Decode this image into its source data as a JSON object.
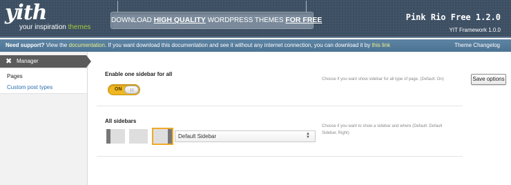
{
  "header": {
    "logo_text": "yith",
    "tagline_prefix": "your inspiration",
    "tagline_accent": "themes",
    "banner_prefix": "DOWNLOAD",
    "banner_bold1": "HIGH QUALITY",
    "banner_middle": "WORDPRESS THEMES",
    "banner_bold2": "FOR FREE",
    "product_name": "Pink Rio Free 1.2.0",
    "framework_version": "YIT Framework 1.0.0"
  },
  "support_bar": {
    "need_support": "Need support?",
    "text_view": "View the",
    "link_documentation": "documentation",
    "text_middle": ". If you want download this documentation and see it without any internet connection, you can download it by",
    "link_this": "this link",
    "changelog": "Theme Changelog"
  },
  "sidebar": {
    "manager_label": "Manager",
    "items": [
      {
        "label": "Pages"
      },
      {
        "label": "Custom post types"
      }
    ]
  },
  "options": {
    "enable_sidebar": {
      "title": "Enable one sidebar for all",
      "toggle_label": "ON",
      "description": "Choose if you want show sidebar for all type of page. (Default: On)"
    },
    "all_sidebars": {
      "title": "All sidebars",
      "selected_layout": "right",
      "select_value": "Default Sidebar",
      "description": "Choose if you want to show a sidebar and where (Default: Default Sidebar, Right)"
    }
  },
  "actions": {
    "save_label": "Save options"
  },
  "colors": {
    "header_bg": "#3d4f63",
    "support_bar_bg": "#5579998",
    "toggle_on": "#efb722",
    "accent_green": "#a3c93a",
    "link_yellow": "#e9f08a",
    "link_blue": "#2c6fae"
  }
}
